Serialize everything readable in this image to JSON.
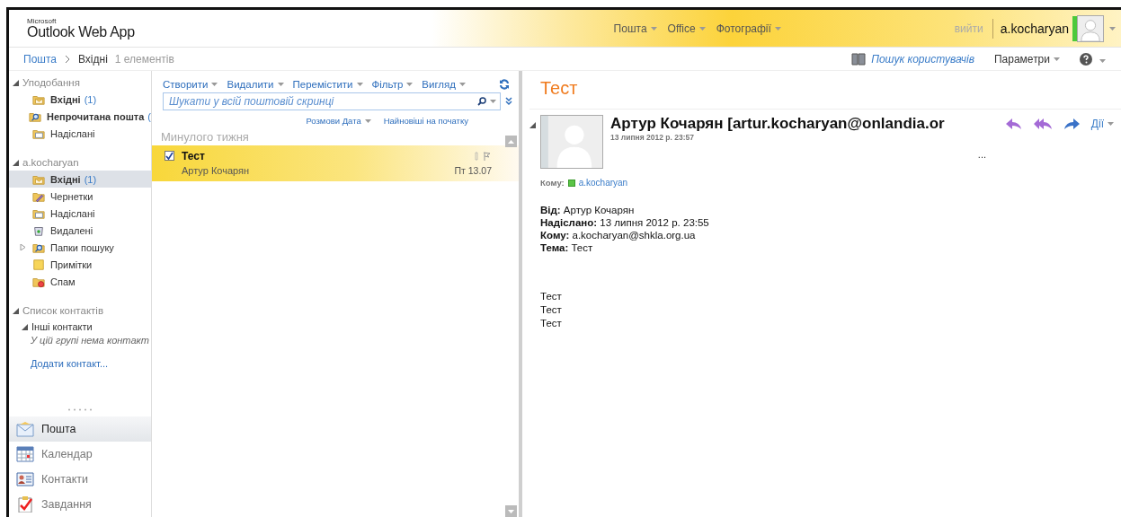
{
  "header": {
    "logo_small": "Microsoft",
    "logo": "Outlook Web App",
    "nav": [
      "Пошта",
      "Office",
      "Фотографії"
    ],
    "signout": "вийти",
    "user": "a.kocharyan",
    "online": true
  },
  "breadcrumb": {
    "root": "Пошта",
    "current": "Вхідні",
    "count": "1 елементів",
    "people_search": "Пошук користувачів",
    "options": "Параметри"
  },
  "sidebar": {
    "sections": [
      {
        "title": "Уподобання",
        "expanded": true,
        "items": [
          {
            "name": "Вхідні",
            "count": "(1)",
            "bold": true,
            "kind": "inbox",
            "selected": false
          },
          {
            "name": "Непрочитана пошта",
            "count": "(",
            "bold": true,
            "kind": "search",
            "selected": false
          },
          {
            "name": "Надіслані",
            "bold": false,
            "kind": "sent",
            "selected": false
          }
        ]
      },
      {
        "title": "a.kocharyan",
        "expanded": true,
        "items": [
          {
            "name": "Вхідні",
            "count": "(1)",
            "bold": true,
            "kind": "inbox",
            "selected": true
          },
          {
            "name": "Чернетки",
            "bold": false,
            "kind": "drafts",
            "selected": false
          },
          {
            "name": "Надіслані",
            "bold": false,
            "kind": "sent",
            "selected": false
          },
          {
            "name": "Видалені",
            "bold": false,
            "kind": "trash",
            "selected": false
          },
          {
            "name": "Папки пошуку",
            "bold": false,
            "kind": "search",
            "selected": false,
            "expanded": false
          },
          {
            "name": "Примітки",
            "bold": false,
            "kind": "notes",
            "selected": false
          },
          {
            "name": "Спам",
            "bold": false,
            "kind": "junk",
            "selected": false
          }
        ]
      }
    ],
    "contacts": {
      "title": "Список контактів",
      "expanded": true,
      "group": "Інші контакти",
      "empty": "У цій групі нема контакт",
      "add": "Додати контакт..."
    },
    "modules": [
      {
        "name": "Пошта",
        "kind": "mail",
        "selected": true
      },
      {
        "name": "Календар",
        "kind": "calendar",
        "selected": false
      },
      {
        "name": "Контакти",
        "kind": "contacts",
        "selected": false
      },
      {
        "name": "Завдання",
        "kind": "tasks",
        "selected": false
      }
    ]
  },
  "list": {
    "toolbar": [
      "Створити",
      "Видалити",
      "Перемістити",
      "Фільтр",
      "Вигляд"
    ],
    "search": {
      "placeholder": "Шукати у всій поштовій скринці"
    },
    "sort": [
      "Розмови Дата",
      "Найновіші на початку"
    ],
    "group": "Минулого тижня",
    "messages": [
      {
        "subject": "Тест",
        "from": "Артур Кочарян",
        "date": "Пт 13.07",
        "checked": true,
        "selected": true,
        "unread": true
      }
    ]
  },
  "reading": {
    "subject": "Тест",
    "sender": "Артур Кочарян [artur.kocharyan@onlandia.or",
    "sent": "13 липня 2012 р. 23:57",
    "actions": "Дії",
    "more": "...",
    "to_label": "Кому:",
    "to": "a.kocharyan",
    "fields": [
      {
        "label": "Від:",
        "value": "Артур Кочарян"
      },
      {
        "label": "Надіслано:",
        "value": "13 липня 2012 р. 23:55"
      },
      {
        "label": "Кому:",
        "value": "a.kocharyan@shkla.org.ua"
      },
      {
        "label": "Тема:",
        "value": "Тест"
      }
    ],
    "body": [
      "Тест",
      "Тест",
      "Тест"
    ]
  }
}
